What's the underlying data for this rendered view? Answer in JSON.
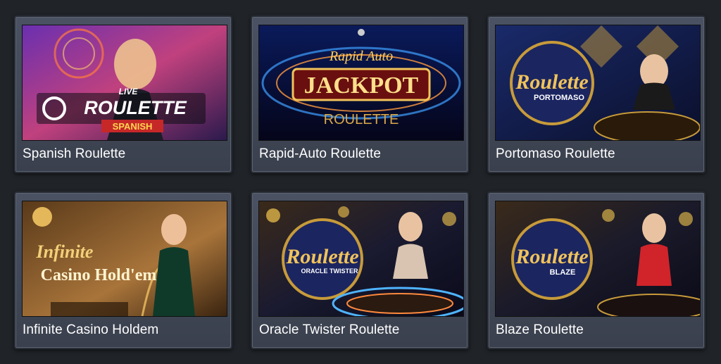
{
  "games": [
    {
      "title": "Spanish Roulette",
      "art": {
        "line1": "LIVE",
        "line2": "ROULETTE",
        "line3": "SPANISH"
      }
    },
    {
      "title": "Rapid-Auto Roulette",
      "art": {
        "line1": "Rapid Auto",
        "line2": "JACKPOT",
        "line3": "ROULETTE"
      }
    },
    {
      "title": "Portomaso Roulette",
      "art": {
        "line1": "Roulette",
        "line2": "PORTOMASO"
      }
    },
    {
      "title": "Infinite Casino Holdem",
      "art": {
        "line1": "Infinite",
        "line2": "Casino Hold'em"
      }
    },
    {
      "title": "Oracle Twister Roulette",
      "art": {
        "line1": "Roulette",
        "line2": "ORACLE TWISTER"
      }
    },
    {
      "title": "Blaze Roulette",
      "art": {
        "line1": "Roulette",
        "line2": "BLAZE"
      }
    }
  ],
  "colors": {
    "page_bg": "#202429",
    "card_bg": "#434a59",
    "title_text": "#ffffff",
    "gold": "#e8b94a"
  }
}
